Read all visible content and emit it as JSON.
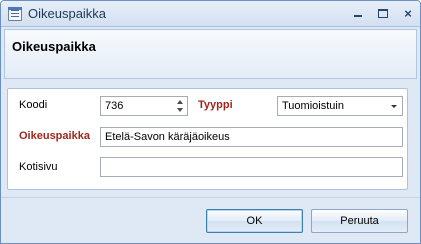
{
  "window": {
    "title": "Oikeuspaikka",
    "controls": {
      "minimize": "minimize",
      "maximize": "maximize",
      "close": "×"
    }
  },
  "header": {
    "title": "Oikeuspaikka"
  },
  "form": {
    "koodi_label": "Koodi",
    "koodi_value": "736",
    "tyyppi_label": "Tyyppi",
    "tyyppi_value": "Tuomioistuin",
    "oikeuspaikka_label": "Oikeuspaikka",
    "oikeuspaikka_value": "Etelä-Savon käräjäoikeus",
    "kotisivu_label": "Kotisivu",
    "kotisivu_value": ""
  },
  "buttons": {
    "ok": "OK",
    "cancel": "Peruuta"
  },
  "colors": {
    "required_label": "#a0271d",
    "title_text": "#1e395b",
    "frame": "#dfe8f5"
  }
}
